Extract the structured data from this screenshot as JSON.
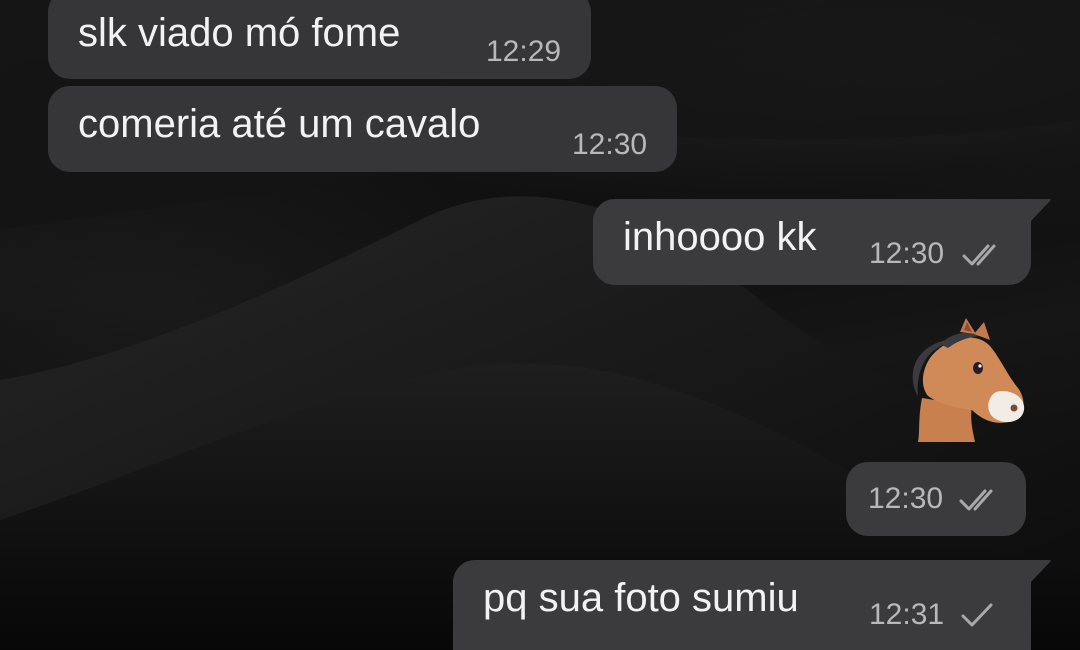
{
  "messages": [
    {
      "direction": "in",
      "text": "slk viado mó fome",
      "time": "12:29"
    },
    {
      "direction": "in",
      "text": "comeria até um cavalo",
      "time": "12:30"
    },
    {
      "direction": "out",
      "text": "inhoooo kk",
      "time": "12:30",
      "status": "read-double-check-icon"
    },
    {
      "direction": "out",
      "sticker": "horse-emoji-icon",
      "time": "12:30",
      "status": "read-double-check-icon"
    },
    {
      "direction": "out",
      "text": "pq sua foto sumiu",
      "time": "12:31",
      "status": "sent-single-check-icon"
    }
  ],
  "colors": {
    "bubble_in": "#363638",
    "bubble_out": "#3b3b3d",
    "text": "#f2f2f2",
    "time": "#b8b8b8"
  }
}
